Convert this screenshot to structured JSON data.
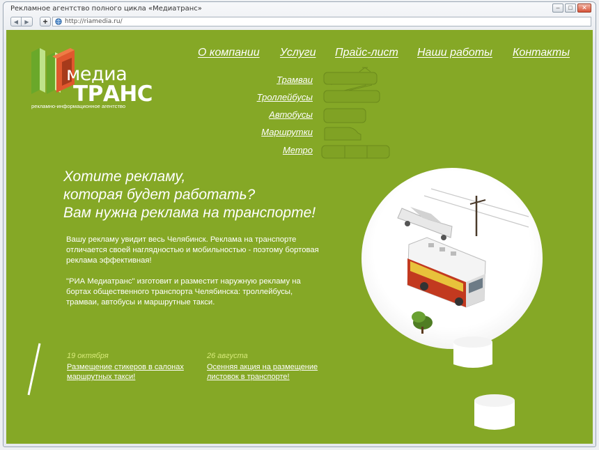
{
  "window": {
    "title": "Рекламное агентство полного цикла «Медиатранс»",
    "url": "http://riamedia.ru/",
    "buttons": [
      "minimize",
      "maximize",
      "close"
    ]
  },
  "logo": {
    "word1": "медиа",
    "word2": "ТРАНС",
    "tagline": "рекламно-информационное агентство"
  },
  "menu": [
    {
      "label": "О компании"
    },
    {
      "label": "Услуги"
    },
    {
      "label": "Прайс-лист"
    },
    {
      "label": "Наши работы"
    },
    {
      "label": "Контакты"
    }
  ],
  "transport": [
    {
      "label": "Трамваи",
      "icon": "tram-icon"
    },
    {
      "label": "Троллейбусы",
      "icon": "trolleybus-icon"
    },
    {
      "label": "Автобусы",
      "icon": "bus-icon"
    },
    {
      "label": "Маршрутки",
      "icon": "minibus-icon"
    },
    {
      "label": "Метро",
      "icon": "metro-icon"
    }
  ],
  "headline": {
    "line1": "Хотите рекламу,",
    "line2": "которая будет работать?",
    "line3": "Вам нужна реклама на транспорте!"
  },
  "intro": {
    "p1": "Вашу рекламу увидит весь Челябинск. Реклама на транспорте отличается своей наглядностью и мобильностью - поэтому бортовая реклама эффективная!",
    "p2": "\"РИА Медиатранс\"  изготовит   и разместит наружную рекламу на бортах общественного транспорта Челябинска: троллейбусы, трамваи, автобусы и маршрутные такси."
  },
  "news": [
    {
      "date": "19 октября",
      "title": "Размещение стикеров в салонах маршрутных такси!"
    },
    {
      "date": "26 августа",
      "title": "Осенняя акция на размещение листовок в транспорте!"
    }
  ],
  "colors": {
    "background": "#85a826",
    "logo_green": "#8fcf3c",
    "logo_orange": "#e8663a",
    "date_accent": "#d7ea79"
  }
}
